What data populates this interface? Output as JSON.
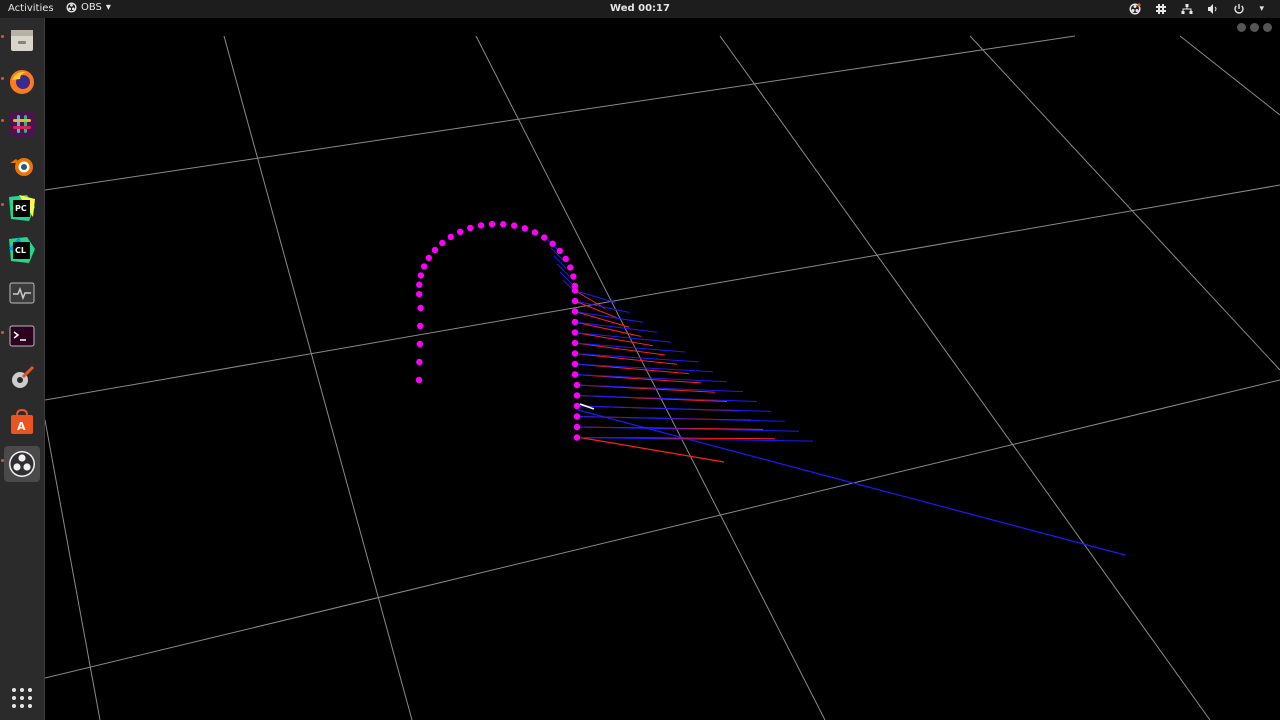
{
  "topbar": {
    "activities": "Activities",
    "app_name": "OBS",
    "clock": "Wed 00:17"
  },
  "dock": {
    "items": [
      {
        "name": "files-icon"
      },
      {
        "name": "firefox-icon"
      },
      {
        "name": "slack-icon"
      },
      {
        "name": "blender-icon"
      },
      {
        "name": "pycharm-icon",
        "label": "PC"
      },
      {
        "name": "clion-icon",
        "label": "CL"
      },
      {
        "name": "system-monitor-icon"
      },
      {
        "name": "terminal-icon"
      },
      {
        "name": "settings-tools-icon"
      },
      {
        "name": "software-center-icon"
      },
      {
        "name": "obs-icon"
      },
      {
        "name": "show-applications-icon"
      }
    ]
  },
  "colors": {
    "accent": "#e95420",
    "trajectory": "#ff00ff",
    "red_vector": "#ff2020",
    "blue_vector": "#1a1aff",
    "grid": "#8a8a8a"
  }
}
